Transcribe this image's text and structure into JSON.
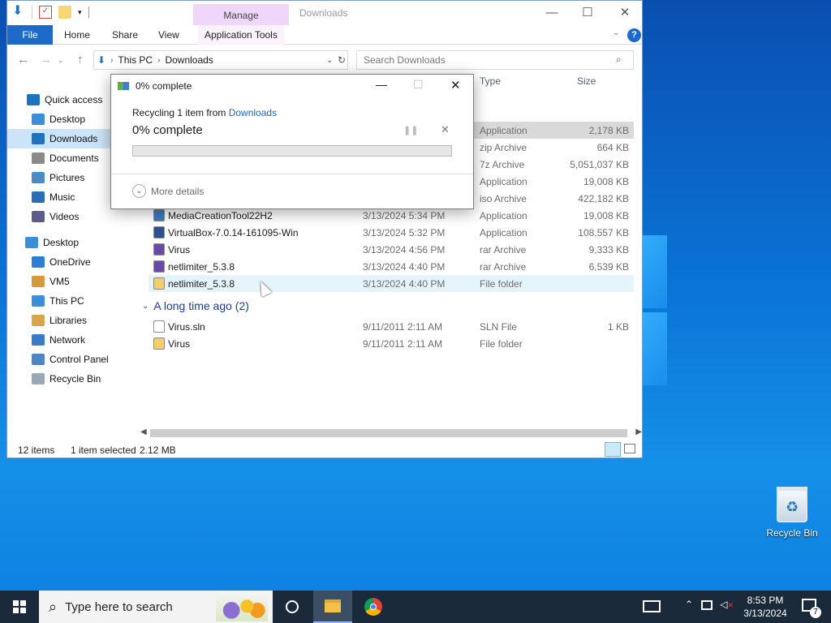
{
  "explorer": {
    "title": "Downloads",
    "ribbon": {
      "context_tab": "Manage",
      "tabs": [
        "File",
        "Home",
        "Share",
        "View",
        "Application Tools"
      ]
    },
    "address": {
      "segments": [
        "This PC",
        "Downloads"
      ]
    },
    "search_placeholder": "Search Downloads",
    "columns": {
      "type": "Type",
      "size": "Size"
    },
    "sidebar": [
      {
        "label": "Quick access",
        "icon": "star-icon",
        "color": "#1e73be"
      },
      {
        "label": "Desktop",
        "icon": "desktop-icon",
        "color": "#3b8fd9"
      },
      {
        "label": "Downloads",
        "icon": "download-icon",
        "color": "#1e73be",
        "selected": true
      },
      {
        "label": "Documents",
        "icon": "documents-icon",
        "color": "#8a8a8a"
      },
      {
        "label": "Pictures",
        "icon": "pictures-icon",
        "color": "#4a8ac9"
      },
      {
        "label": "Music",
        "icon": "music-icon",
        "color": "#2a6db5"
      },
      {
        "label": "Videos",
        "icon": "videos-icon",
        "color": "#5c5c8a"
      },
      {
        "label": "Desktop",
        "icon": "desktop-icon",
        "color": "#3b8fd9"
      },
      {
        "label": "OneDrive",
        "icon": "onedrive-icon",
        "color": "#2d7fd3"
      },
      {
        "label": "VM5",
        "icon": "user-icon",
        "color": "#d69a3a"
      },
      {
        "label": "This PC",
        "icon": "pc-icon",
        "color": "#3b8fd9"
      },
      {
        "label": "Libraries",
        "icon": "libraries-icon",
        "color": "#d9a54a"
      },
      {
        "label": "Network",
        "icon": "network-icon",
        "color": "#3b7ac9"
      },
      {
        "label": "Control Panel",
        "icon": "control-panel-icon",
        "color": "#4c86c6"
      },
      {
        "label": "Recycle Bin",
        "icon": "recycle-bin-icon",
        "color": "#9aa8b5"
      }
    ],
    "files_partial": [
      {
        "type": "Application",
        "size": "2,178 KB",
        "selected": true
      },
      {
        "type": "zip Archive",
        "size": "664 KB"
      },
      {
        "type": "7z Archive",
        "size": "5,051,037 KB"
      },
      {
        "type": "Application",
        "size": "19,008 KB"
      },
      {
        "type": "iso Archive",
        "size": "422,182 KB"
      }
    ],
    "files": [
      {
        "name": "MediaCreationTool22H2",
        "date": "3/13/2024 5:34 PM",
        "type": "Application",
        "size": "19,008 KB",
        "icon": "app-icon",
        "color": "#3c7bc4"
      },
      {
        "name": "VirtualBox-7.0.14-161095-Win",
        "date": "3/13/2024 5:32 PM",
        "type": "Application",
        "size": "108,557 KB",
        "icon": "virtualbox-icon",
        "color": "#2f4f8f"
      },
      {
        "name": "Virus",
        "date": "3/13/2024 4:56 PM",
        "type": "rar Archive",
        "size": "9,333 KB",
        "icon": "rar-icon",
        "color": "#6a4aa8"
      },
      {
        "name": "netlimiter_5.3.8",
        "date": "3/13/2024 4:40 PM",
        "type": "rar Archive",
        "size": "6,539 KB",
        "icon": "rar-icon",
        "color": "#6a4aa8"
      },
      {
        "name": "netlimiter_5.3.8",
        "date": "3/13/2024 4:40 PM",
        "type": "File folder",
        "size": "",
        "icon": "folder-icon",
        "color": "#f1cf6b",
        "hover": true
      }
    ],
    "group_label": "A long time ago (2)",
    "old_files": [
      {
        "name": "Virus.sln",
        "date": "9/11/2011 2:11 AM",
        "type": "SLN File",
        "size": "1 KB",
        "icon": "file-icon",
        "color": "#ffffff"
      },
      {
        "name": "Virus",
        "date": "9/11/2011 2:11 AM",
        "type": "File folder",
        "size": "",
        "icon": "folder-icon",
        "color": "#f1cf6b"
      }
    ],
    "status": {
      "count": "12 items",
      "selected": "1 item selected",
      "size": "2.12 MB"
    }
  },
  "dialog": {
    "title": "0% complete",
    "action_prefix": "Recycling 1 item from ",
    "action_link": "Downloads",
    "percent_label": "0% complete",
    "progress": 0,
    "more_details": "More details"
  },
  "desktop": {
    "recycle_bin": "Recycle Bin"
  },
  "taskbar": {
    "search_placeholder": "Type here to search",
    "time": "8:53 PM",
    "date": "3/13/2024",
    "notifications": "7"
  },
  "colors": {
    "accent": "#1e6ac9",
    "link": "#1e66b6",
    "selection": "#cce4f7"
  }
}
